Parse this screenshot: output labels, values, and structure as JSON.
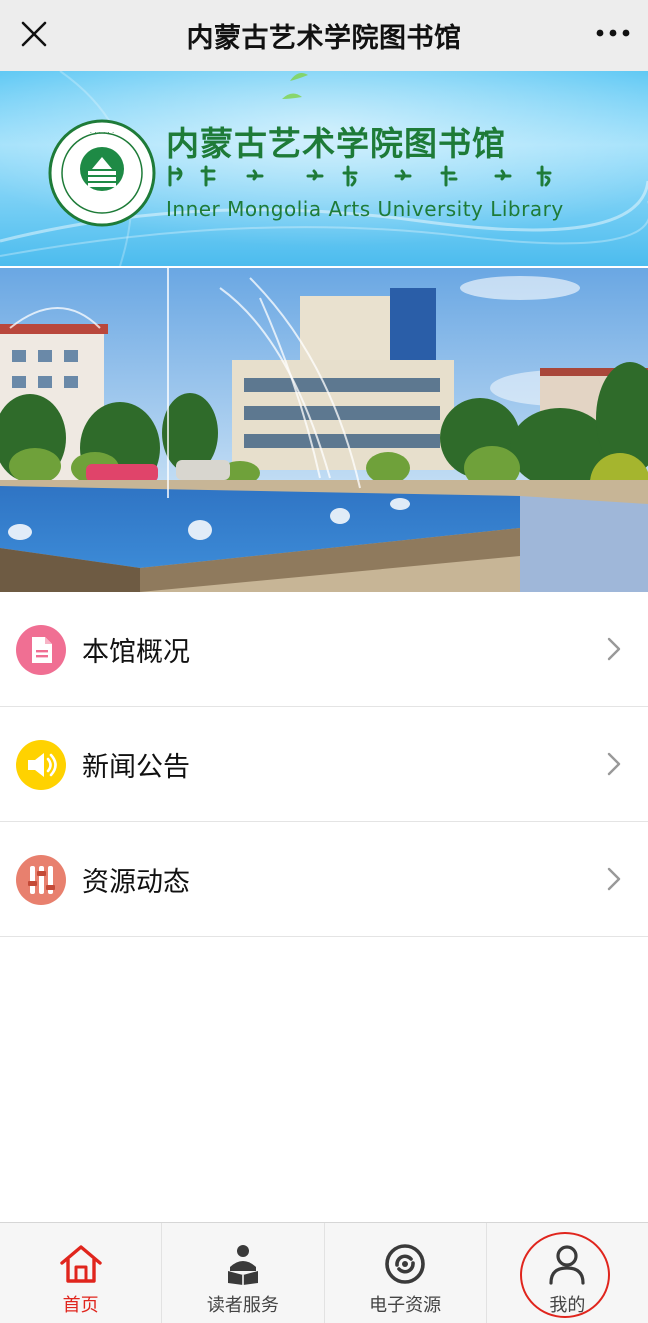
{
  "topbar": {
    "title": "内蒙古艺术学院图书馆",
    "close_icon": "close-icon",
    "more_icon": "more-icon"
  },
  "banner": {
    "title": "内蒙古艺术学院图书馆",
    "subtitle_en": "Inner Mongolia Arts University Library",
    "logo": "library-seal-logo"
  },
  "photo": {
    "alt": "campus-fountain-photo"
  },
  "menu": {
    "items": [
      {
        "label": "本馆概况",
        "icon": "document-icon",
        "color": "#f06f93"
      },
      {
        "label": "新闻公告",
        "icon": "speaker-icon",
        "color": "#ffd200"
      },
      {
        "label": "资源动态",
        "icon": "equalizer-icon",
        "color": "#e8806e"
      }
    ]
  },
  "tabbar": {
    "tabs": [
      {
        "label": "首页",
        "icon": "home-icon",
        "active": true
      },
      {
        "label": "读者服务",
        "icon": "reader-service-icon",
        "active": false
      },
      {
        "label": "电子资源",
        "icon": "e-resource-icon",
        "active": false
      },
      {
        "label": "我的",
        "icon": "user-icon",
        "active": false
      }
    ]
  },
  "colors": {
    "accent_red": "#e0251d",
    "banner_green": "#1e7b38",
    "topbar_bg": "#ededed"
  }
}
